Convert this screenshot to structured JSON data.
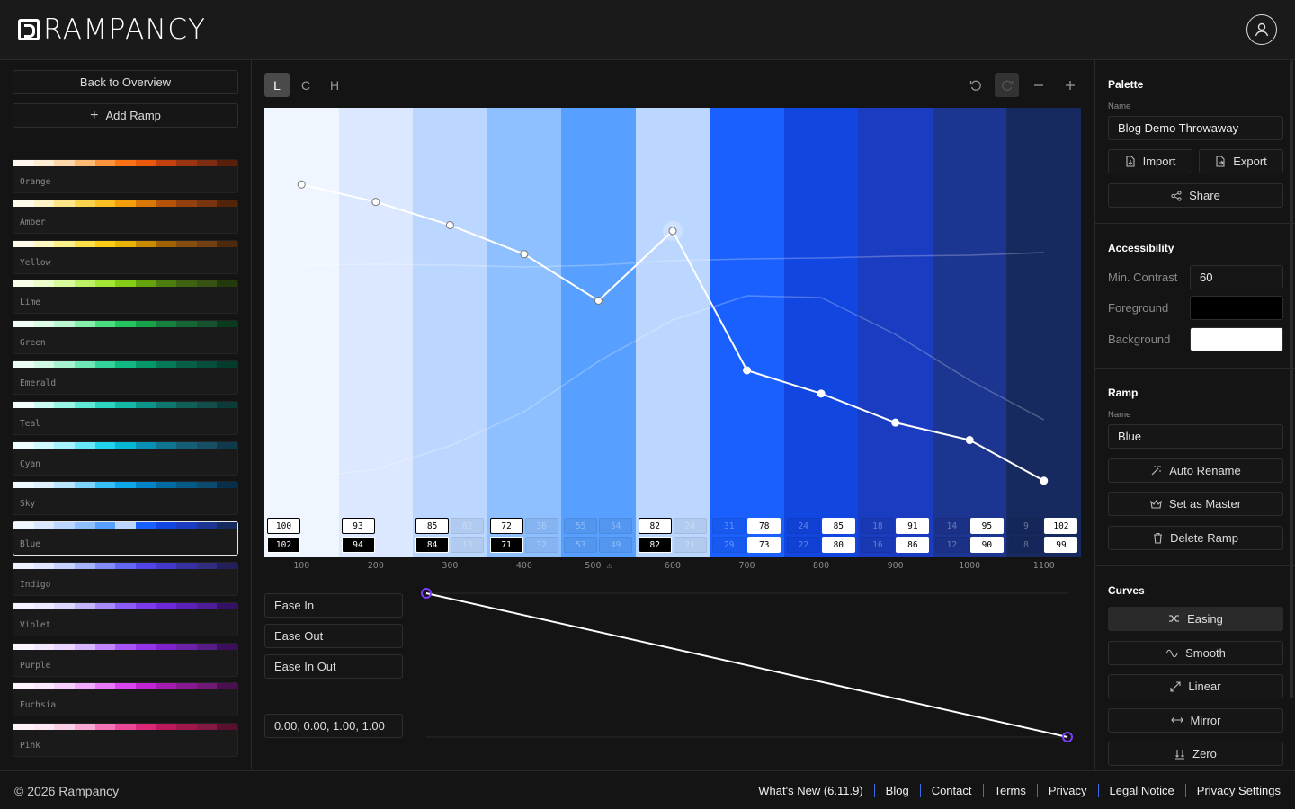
{
  "header": {
    "logo_text": "RAMPANCY",
    "profile_icon": "user-icon"
  },
  "sidebar": {
    "back_label": "Back to Overview",
    "add_label": "Add Ramp",
    "ramps": [
      {
        "name": "Orange",
        "colors": [
          "#fff7ed",
          "#ffedd5",
          "#fed7aa",
          "#fdba74",
          "#fb923c",
          "#f97316",
          "#ea580c",
          "#c2410c",
          "#9a3412",
          "#7c2d12",
          "#5a1f0b"
        ]
      },
      {
        "name": "Amber",
        "colors": [
          "#fffbeb",
          "#fef3c7",
          "#fde68a",
          "#fcd34d",
          "#fbbf24",
          "#f59e0b",
          "#d97706",
          "#b45309",
          "#92400e",
          "#78350f",
          "#52240a"
        ]
      },
      {
        "name": "Yellow",
        "colors": [
          "#fefce8",
          "#fef9c3",
          "#fef08a",
          "#fde047",
          "#facc15",
          "#eab308",
          "#ca8a04",
          "#a16207",
          "#854d0e",
          "#713f12",
          "#4c2a0b"
        ]
      },
      {
        "name": "Lime",
        "colors": [
          "#f7fee7",
          "#ecfccb",
          "#d9f99d",
          "#bef264",
          "#a3e635",
          "#84cc16",
          "#65a30d",
          "#4d7c0f",
          "#3f6212",
          "#365314",
          "#233a0c"
        ]
      },
      {
        "name": "Green",
        "colors": [
          "#f0fdf4",
          "#dcfce7",
          "#bbf7d0",
          "#86efac",
          "#4ade80",
          "#22c55e",
          "#16a34a",
          "#15803d",
          "#166534",
          "#14532d",
          "#0b3b1e"
        ]
      },
      {
        "name": "Emerald",
        "colors": [
          "#ecfdf5",
          "#d1fae5",
          "#a7f3d0",
          "#6ee7b7",
          "#34d399",
          "#10b981",
          "#059669",
          "#047857",
          "#065f46",
          "#064e3b",
          "#033b2c"
        ]
      },
      {
        "name": "Teal",
        "colors": [
          "#f0fdfa",
          "#ccfbf1",
          "#99f6e4",
          "#5eead4",
          "#2dd4bf",
          "#14b8a6",
          "#0d9488",
          "#0f766e",
          "#115e59",
          "#134e4a",
          "#0b3a37"
        ]
      },
      {
        "name": "Cyan",
        "colors": [
          "#ecfeff",
          "#cffafe",
          "#a5f3fc",
          "#67e8f9",
          "#22d3ee",
          "#06b6d4",
          "#0891b2",
          "#0e7490",
          "#155e75",
          "#164e63",
          "#0e3a4b"
        ]
      },
      {
        "name": "Sky",
        "colors": [
          "#f0f9ff",
          "#e0f2fe",
          "#bae6fd",
          "#7dd3fc",
          "#38bdf8",
          "#0ea5e9",
          "#0284c7",
          "#0369a1",
          "#075985",
          "#0c4a6e",
          "#082f4a"
        ]
      },
      {
        "name": "Blue",
        "colors": [
          "#f0f6ff",
          "#dbe8ff",
          "#bcd7ff",
          "#8ec0ff",
          "#58a0ff",
          "#bcd7ff",
          "#1a60ff",
          "#1246e0",
          "#1a3cc0",
          "#1c3590",
          "#172a60"
        ]
      },
      {
        "name": "Indigo",
        "colors": [
          "#eef2ff",
          "#e0e7ff",
          "#c7d2fe",
          "#a5b4fc",
          "#818cf8",
          "#6366f1",
          "#4f46e5",
          "#4338ca",
          "#3730a3",
          "#312e81",
          "#221f5c"
        ]
      },
      {
        "name": "Violet",
        "colors": [
          "#f5f3ff",
          "#ede9fe",
          "#ddd6fe",
          "#c4b5fd",
          "#a78bfa",
          "#8b5cf6",
          "#7c3aed",
          "#6d28d9",
          "#5b21b6",
          "#4c1d95",
          "#331266"
        ]
      },
      {
        "name": "Purple",
        "colors": [
          "#faf5ff",
          "#f3e8ff",
          "#e9d5ff",
          "#d8b4fe",
          "#c084fc",
          "#a855f7",
          "#9333ea",
          "#7e22ce",
          "#6b21a8",
          "#581c87",
          "#3b0f5c"
        ]
      },
      {
        "name": "Fuchsia",
        "colors": [
          "#fdf4ff",
          "#fae8ff",
          "#f5d0fe",
          "#f0abfc",
          "#e879f9",
          "#d946ef",
          "#c026d3",
          "#a21caf",
          "#86198f",
          "#701a75",
          "#4a0f4f"
        ]
      },
      {
        "name": "Pink",
        "colors": [
          "#fdf2f8",
          "#fce7f3",
          "#fbcfe8",
          "#f9a8d4",
          "#f472b6",
          "#ec4899",
          "#db2777",
          "#be185d",
          "#9d174d",
          "#831843",
          "#5a0f2e"
        ]
      }
    ],
    "active_ramp": "Blue"
  },
  "editor": {
    "tabs": [
      "L",
      "C",
      "H"
    ],
    "active_tab": "L",
    "tool_icons": [
      "undo-icon",
      "redo-icon",
      "zoom-out-icon",
      "zoom-in-icon"
    ],
    "steps": [
      {
        "label": "100",
        "color": "#f0f6ff",
        "lightness": 88,
        "contrast_top": "100",
        "contrast_bottom": "102",
        "top_style": "light",
        "bottom_style": "dark",
        "right_top": "",
        "right_bottom": ""
      },
      {
        "label": "200",
        "color": "#dbe8ff",
        "lightness": 85,
        "contrast_top": "93",
        "contrast_bottom": "94",
        "top_style": "light",
        "bottom_style": "dark",
        "right_top": "",
        "right_bottom": "",
        "right_ghost": true
      },
      {
        "label": "300",
        "color": "#bcd7ff",
        "lightness": 81,
        "contrast_top": "85",
        "contrast_bottom": "84",
        "top_style": "light",
        "bottom_style": "dark",
        "right_top": "82",
        "right_bottom": "13"
      },
      {
        "label": "400",
        "color": "#8ec0ff",
        "lightness": 76,
        "contrast_top": "72",
        "contrast_bottom": "71",
        "top_style": "light",
        "bottom_style": "dark",
        "right_top": "36",
        "right_bottom": "32"
      },
      {
        "label": "500",
        "color": "#58a0ff",
        "lightness": 68,
        "contrast_top": "55",
        "contrast_bottom": "53",
        "top_style": "ghost",
        "bottom_style": "ghost",
        "right_top": "54",
        "right_bottom": "49",
        "warn": true
      },
      {
        "label": "600",
        "color": "#bcd7ff",
        "lightness": 80,
        "contrast_top": "82",
        "contrast_bottom": "82",
        "top_style": "light",
        "bottom_style": "dark",
        "right_top": "24",
        "right_bottom": "21"
      },
      {
        "label": "700",
        "color": "#1a60ff",
        "lightness": 56,
        "contrast_top": "31",
        "contrast_bottom": "29",
        "top_style": "ghost",
        "bottom_style": "ghost",
        "right_top": "78",
        "right_bottom": "73",
        "right_style": "white"
      },
      {
        "label": "800",
        "color": "#1246e0",
        "lightness": 52,
        "contrast_top": "24",
        "contrast_bottom": "22",
        "top_style": "ghost",
        "bottom_style": "ghost",
        "right_top": "85",
        "right_bottom": "80",
        "right_style": "white"
      },
      {
        "label": "900",
        "color": "#1a3cc0",
        "lightness": 47,
        "contrast_top": "18",
        "contrast_bottom": "16",
        "top_style": "ghost",
        "bottom_style": "ghost",
        "right_top": "91",
        "right_bottom": "86",
        "right_style": "white"
      },
      {
        "label": "1000",
        "color": "#1c3590",
        "lightness": 44,
        "contrast_top": "14",
        "contrast_bottom": "12",
        "top_style": "ghost",
        "bottom_style": "ghost",
        "right_top": "95",
        "right_bottom": "90",
        "right_style": "white"
      },
      {
        "label": "1100",
        "color": "#172a60",
        "lightness": 37,
        "contrast_top": "9",
        "contrast_bottom": "8",
        "top_style": "ghost",
        "bottom_style": "ghost",
        "right_top": "102",
        "right_bottom": "99",
        "right_style": "white",
        "last": true
      }
    ],
    "ease_buttons": [
      "Ease In",
      "Ease Out",
      "Ease In Out"
    ],
    "bezier_value": "0.00, 0.00, 1.00, 1.00",
    "curve_color": "#7b3cff"
  },
  "panel": {
    "palette_title": "Palette",
    "name_label": "Name",
    "palette_name": "Blog Demo Throwaway",
    "import_label": "Import",
    "export_label": "Export",
    "share_label": "Share",
    "accessibility_title": "Accessibility",
    "min_contrast_label": "Min. Contrast",
    "min_contrast_value": "60",
    "foreground_label": "Foreground",
    "foreground_color": "#000000",
    "background_label": "Background",
    "background_color": "#ffffff",
    "ramp_title": "Ramp",
    "ramp_name_label": "Name",
    "ramp_name": "Blue",
    "auto_rename_label": "Auto Rename",
    "set_master_label": "Set as Master",
    "delete_label": "Delete Ramp",
    "curves_title": "Curves",
    "curves": [
      "Easing",
      "Smooth",
      "Linear",
      "Mirror",
      "Zero"
    ],
    "active_curve": "Easing"
  },
  "footer": {
    "copyright": "© 2026 Rampancy",
    "links": [
      "What's New (6.11.9)",
      "Blog",
      "Contact",
      "Terms",
      "Privacy",
      "Legal Notice",
      "Privacy Settings"
    ]
  }
}
